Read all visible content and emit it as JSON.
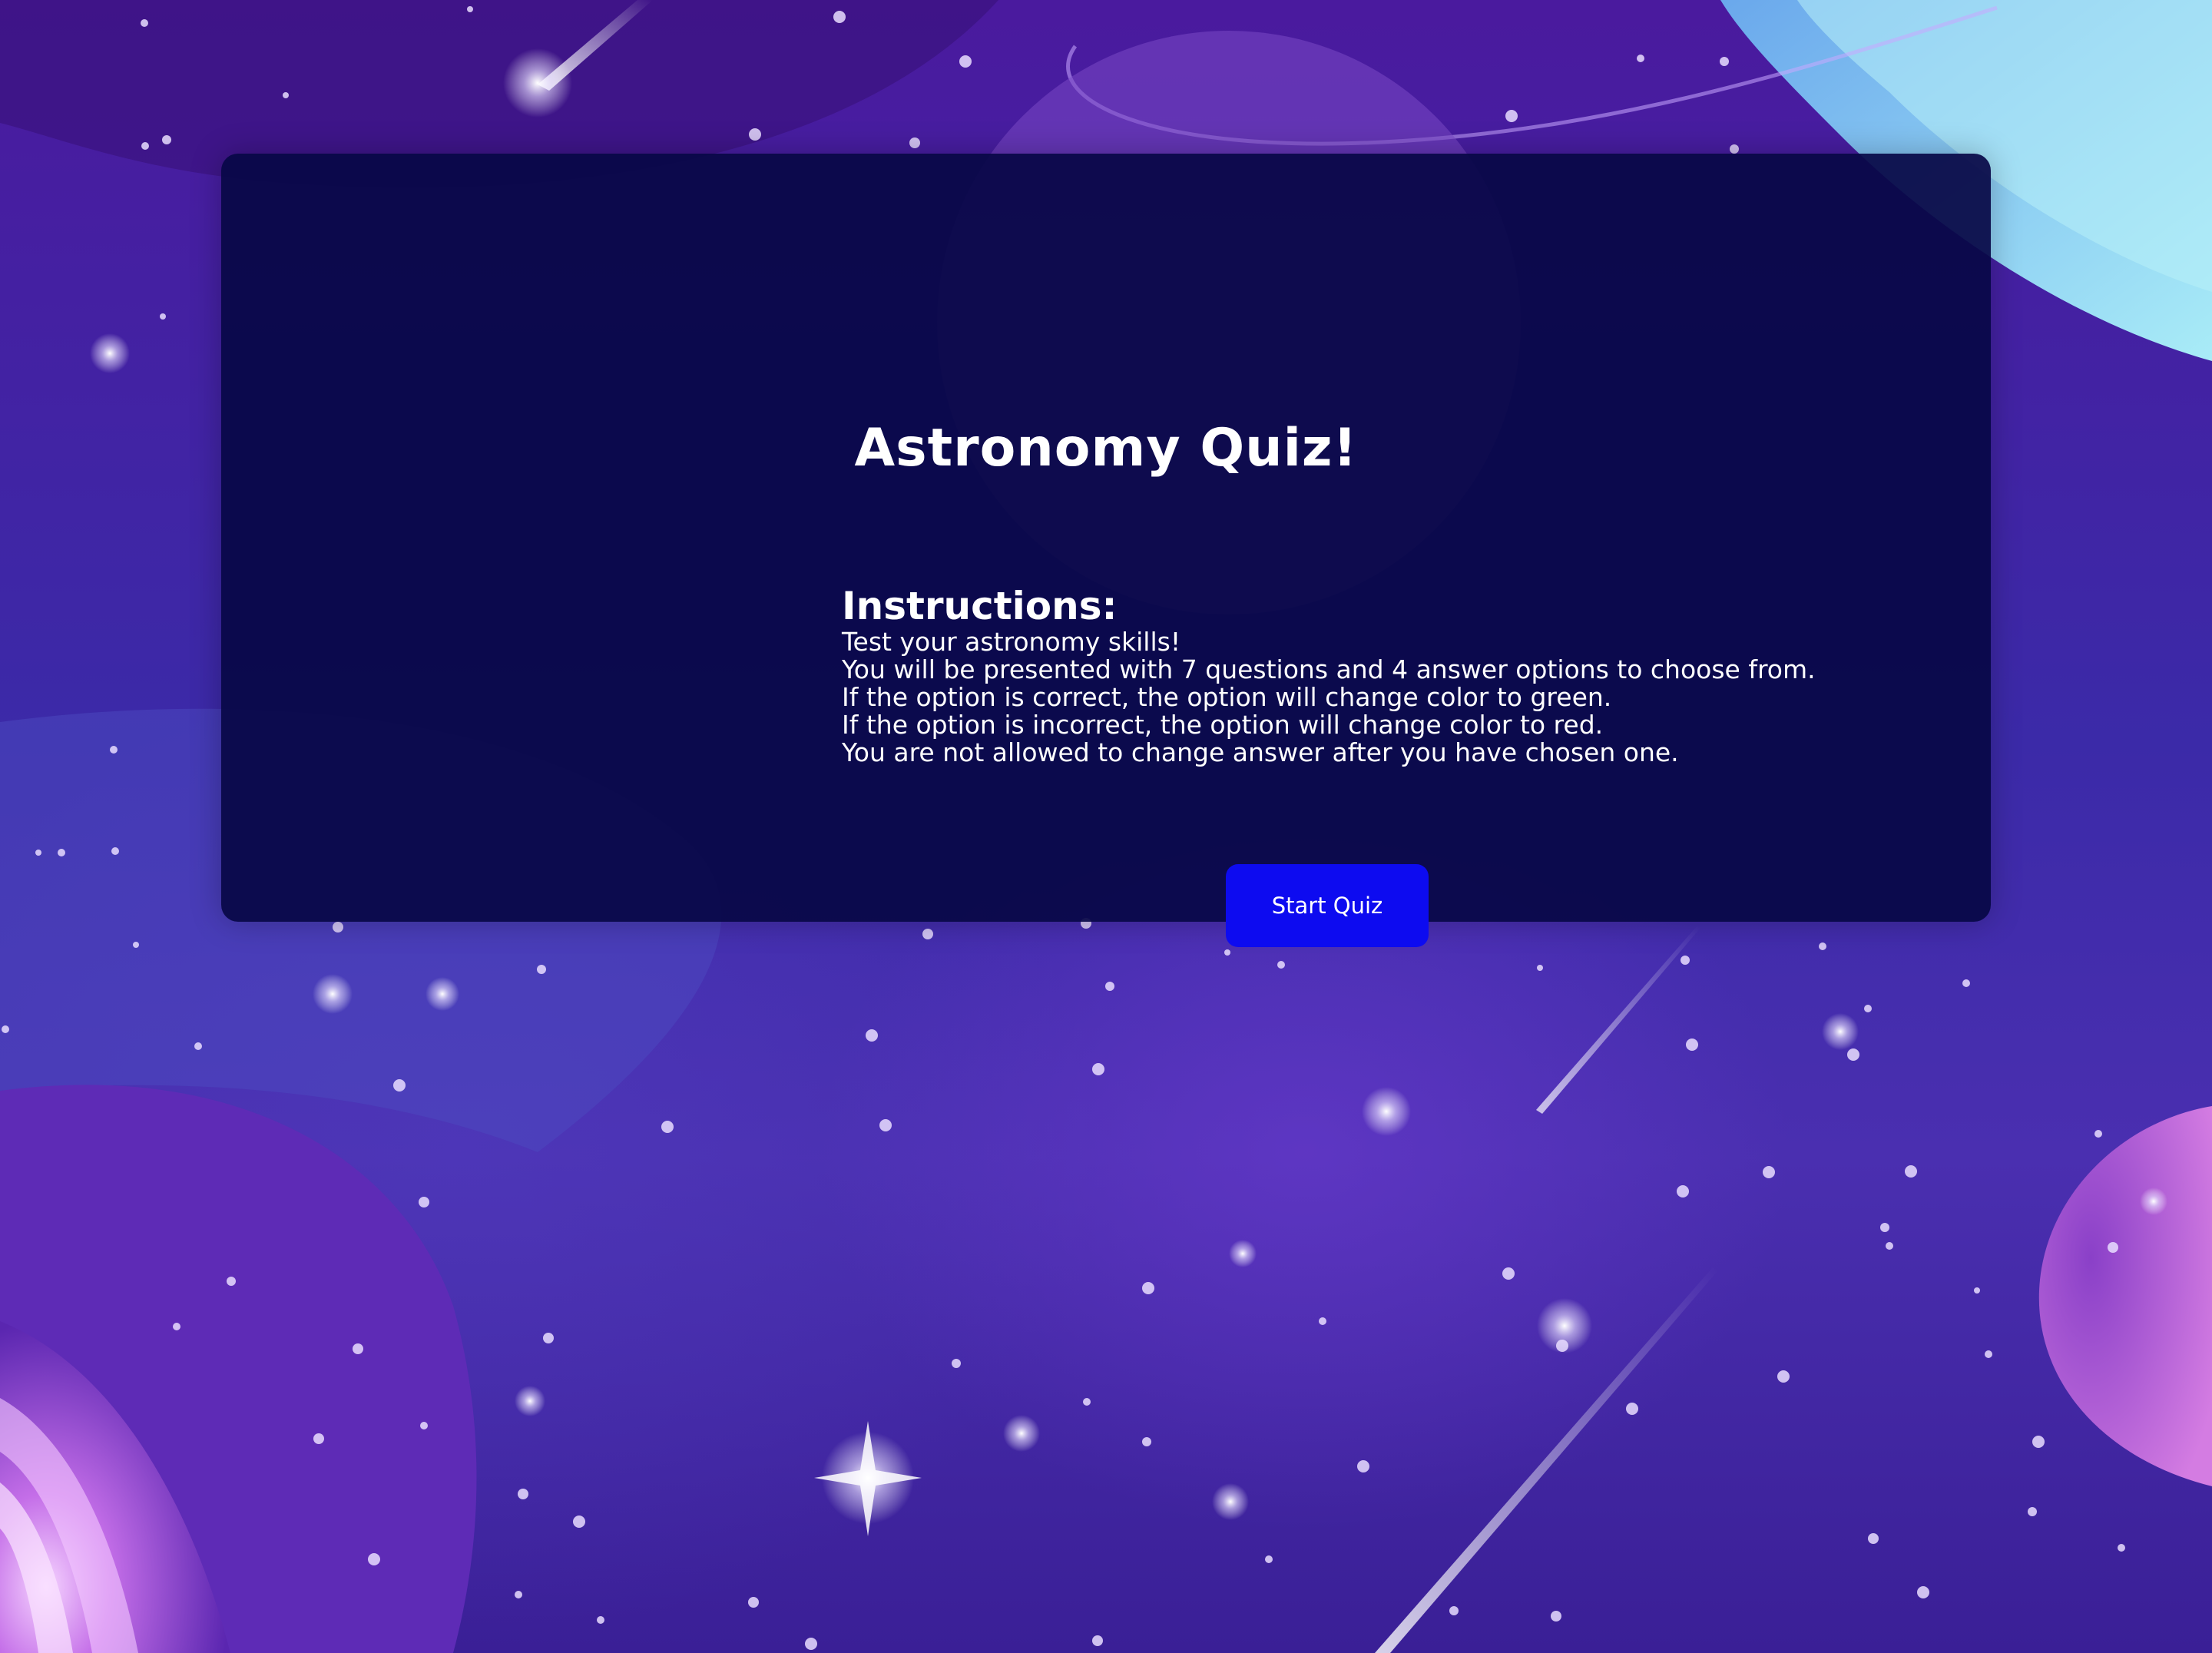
{
  "quiz": {
    "title": "Astronomy Quiz!",
    "instructions_heading": "Instructions:",
    "instructions": [
      "Test your astronomy skills!",
      "You will be presented with 7 questions and 4 answer options to choose from.",
      "If the option is correct, the option will change color to green.",
      "If the option is incorrect, the option will change color to red.",
      "You are not allowed to change answer after you have chosen one."
    ],
    "start_button_label": "Start Quiz"
  },
  "colors": {
    "card_background": "#08084a",
    "button_background": "#0d0bf0",
    "text": "#ffffff",
    "space_background": "#3b2aa8"
  }
}
